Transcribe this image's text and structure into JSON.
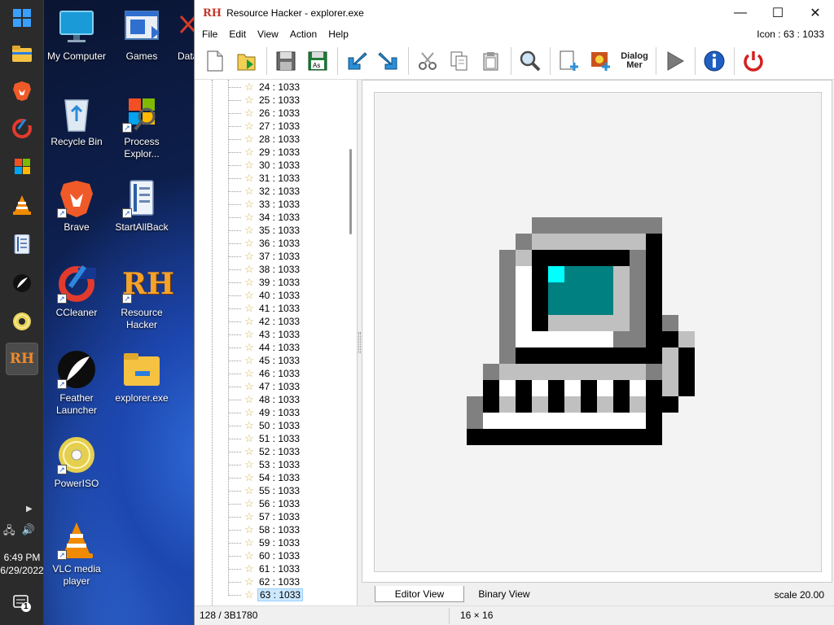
{
  "window": {
    "app_logo": "RH",
    "title": "Resource Hacker - explorer.exe",
    "minimize": "—",
    "maximize": "☐",
    "close": "✕"
  },
  "menu": [
    "File",
    "Edit",
    "View",
    "Action",
    "Help"
  ],
  "icon_info": "Icon : 63 : 1033",
  "toolbar": {
    "dialog_menu_label_1": "Dialog",
    "dialog_menu_label_2": "Mer"
  },
  "tree": {
    "items": [
      "24 : 1033",
      "25 : 1033",
      "26 : 1033",
      "27 : 1033",
      "28 : 1033",
      "29 : 1033",
      "30 : 1033",
      "31 : 1033",
      "32 : 1033",
      "33 : 1033",
      "34 : 1033",
      "35 : 1033",
      "36 : 1033",
      "37 : 1033",
      "38 : 1033",
      "39 : 1033",
      "40 : 1033",
      "41 : 1033",
      "42 : 1033",
      "43 : 1033",
      "44 : 1033",
      "45 : 1033",
      "46 : 1033",
      "47 : 1033",
      "48 : 1033",
      "49 : 1033",
      "50 : 1033",
      "51 : 1033",
      "52 : 1033",
      "53 : 1033",
      "54 : 1033",
      "55 : 1033",
      "56 : 1033",
      "57 : 1033",
      "58 : 1033",
      "59 : 1033",
      "60 : 1033",
      "61 : 1033",
      "62 : 1033",
      "63 : 1033"
    ],
    "selected": "63 : 1033"
  },
  "tabs": {
    "editor": "Editor View",
    "binary": "Binary View"
  },
  "scale": "scale 20.00",
  "status": {
    "left": "128 / 3B1780",
    "mid": "16 × 16"
  },
  "desktop": {
    "icons": [
      {
        "label": "My Computer"
      },
      {
        "label": "Games"
      },
      {
        "label": "Data"
      },
      {
        "label": "Recycle Bin"
      },
      {
        "label": "Process Explor..."
      },
      {
        "label": "Brave"
      },
      {
        "label": "StartAllBack"
      },
      {
        "label": "CCleaner"
      },
      {
        "label": "Resource Hacker"
      },
      {
        "label": "Feather Launcher"
      },
      {
        "label": "explorer.exe"
      },
      {
        "label": "PowerISO"
      },
      {
        "label": "VLC media player"
      }
    ]
  },
  "clock": {
    "time": "6:49 PM",
    "date": "6/29/2022"
  },
  "notification_count": "1"
}
